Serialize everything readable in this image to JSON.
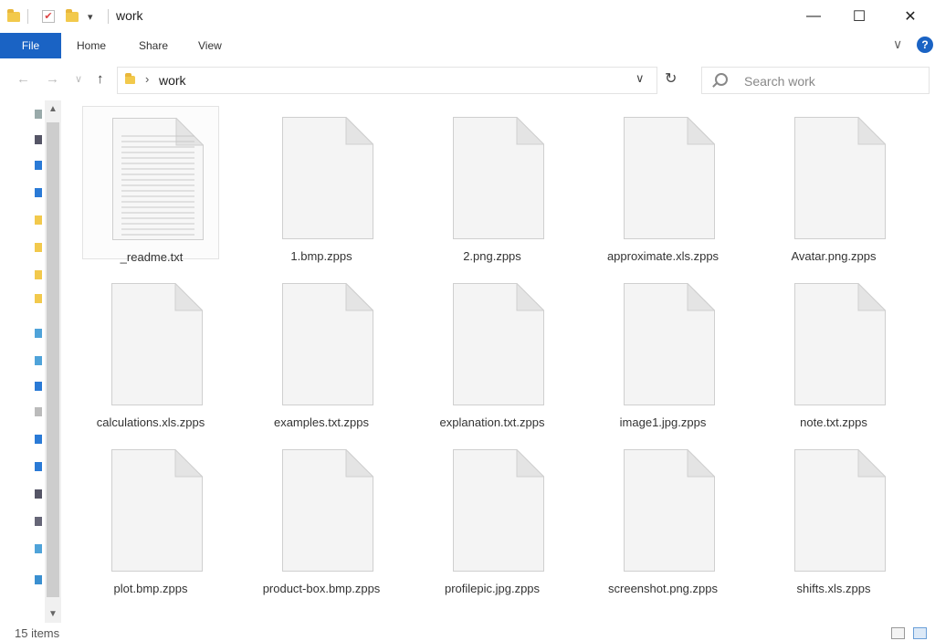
{
  "window": {
    "title": "work",
    "minimize_glyph": "—",
    "maximize_glyph": "☐",
    "close_glyph": "✕",
    "qa_dropdown_glyph": "▾",
    "check_glyph": "✔"
  },
  "ribbon": {
    "file_label": "File",
    "tabs": [
      "Home",
      "Share",
      "View"
    ],
    "help_glyph": "?",
    "expand_glyph": "∨"
  },
  "address": {
    "back_glyph": "←",
    "forward_glyph": "→",
    "recent_glyph": "∨",
    "up_glyph": "↑",
    "separator_glyph": "›",
    "path": "work",
    "dropdown_glyph": "∨",
    "refresh_glyph": "↻"
  },
  "search": {
    "placeholder": "Search work"
  },
  "files": [
    {
      "name": "_readme.txt"
    },
    {
      "name": "1.bmp.zpps"
    },
    {
      "name": "2.png.zpps"
    },
    {
      "name": "approximate.xls.zpps"
    },
    {
      "name": "Avatar.png.zpps"
    },
    {
      "name": "calculations.xls.zpps"
    },
    {
      "name": "examples.txt.zpps"
    },
    {
      "name": "explanation.txt.zpps"
    },
    {
      "name": "image1.jpg.zpps"
    },
    {
      "name": "note.txt.zpps"
    },
    {
      "name": "plot.bmp.zpps"
    },
    {
      "name": "product-box.bmp.zpps"
    },
    {
      "name": "profilepic.jpg.zpps"
    },
    {
      "name": "screenshot.png.zpps"
    },
    {
      "name": "shifts.xls.zpps"
    }
  ],
  "status": {
    "item_count": "15 items"
  },
  "colors": {
    "accent": "#1a63c4",
    "folder": "#f2c94c"
  }
}
